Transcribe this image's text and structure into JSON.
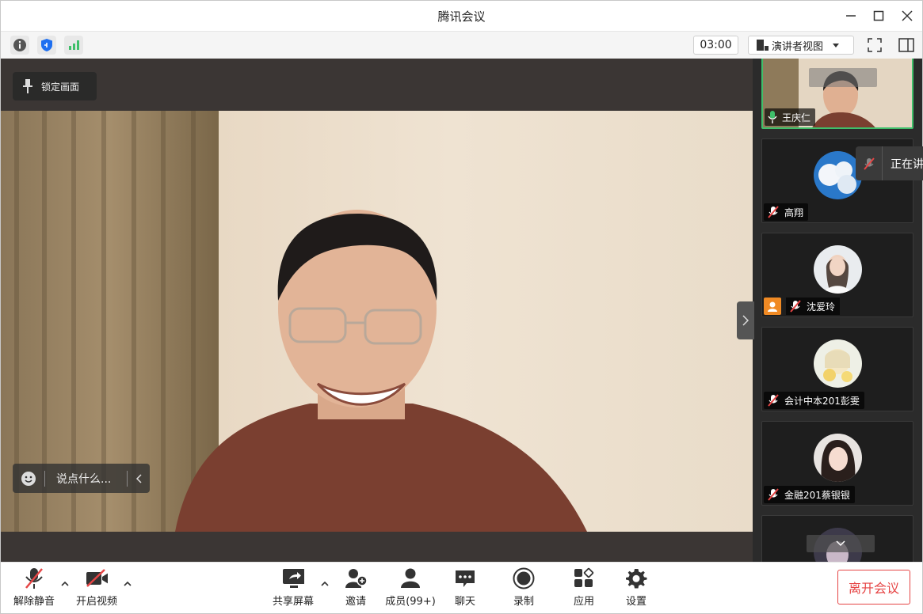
{
  "window": {
    "title": "腾讯会议"
  },
  "infobar": {
    "timer": "03:00",
    "view_mode": "演讲者视图"
  },
  "stage": {
    "lock_label": "锁定画面",
    "chat_placeholder": "说点什么..."
  },
  "participants": [
    {
      "name": "王庆仁",
      "mic": "on"
    },
    {
      "name": "高翔",
      "mic": "muted"
    },
    {
      "name": "沈爱玲",
      "mic": "muted",
      "host_badge": true
    },
    {
      "name": "会计中本201彭雯",
      "mic": "muted"
    },
    {
      "name": "金融201蔡银银",
      "mic": "muted"
    }
  ],
  "speaking_popup": "正在讲",
  "toolbar": {
    "unmute": "解除静音",
    "start_video": "开启视频",
    "share_screen": "共享屏幕",
    "invite": "邀请",
    "members": "成员(99+)",
    "chat": "聊天",
    "record": "录制",
    "apps": "应用",
    "settings": "设置",
    "leave": "离开会议"
  },
  "colors": {
    "accent_green": "#3fbf6a",
    "leave_red": "#e64545",
    "shield_blue": "#1e6ff0"
  }
}
